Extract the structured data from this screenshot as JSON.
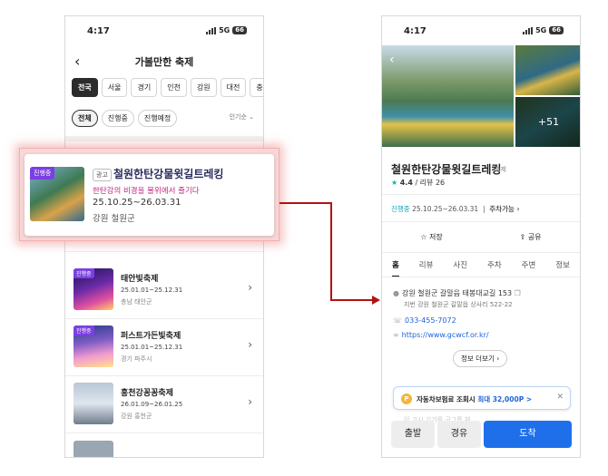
{
  "left_screen": {
    "status": {
      "time": "4:17",
      "network": "5G",
      "battery": "66"
    },
    "header": {
      "title": "가볼만한 축제"
    },
    "regions": [
      "전국",
      "서울",
      "경기",
      "인천",
      "강원",
      "대전",
      "충남"
    ],
    "active_region": "전국",
    "filters": [
      "전체",
      "진행중",
      "진행예정"
    ],
    "sort": "인기순 ⌄",
    "festivals": [
      {
        "badge": "진행중",
        "name": "태안빛축제",
        "date": "25.01.01~25.12.31",
        "location": "충남 태안군"
      },
      {
        "badge": "진행중",
        "name": "퍼스트가든빛축제",
        "date": "25.01.01~25.12.31",
        "location": "경기 파주시"
      },
      {
        "badge": "",
        "name": "홍천강꽁꽁축제",
        "date": "26.01.09~26.01.25",
        "location": "강원 홍천군"
      }
    ]
  },
  "highlight_card": {
    "badge": "진행중",
    "ad_label": "광고",
    "name": "철원한탄강물윗길트레킹",
    "subtitle": "한탄강의 비경을 물위에서 즐기다",
    "date": "25.10.25~26.03.31",
    "location": "강원 철원군"
  },
  "right_screen": {
    "status": {
      "time": "4:17",
      "network": "5G",
      "battery": "66"
    },
    "gallery": {
      "more_count": "+51"
    },
    "place": {
      "name": "철원한탄강물윗길트레킹",
      "category": "축제",
      "rating": "4.4",
      "reviews": "/ 리뷰 26",
      "status": "진행중",
      "period": "25.10.25~26.03.31",
      "parking": "주차가능 ›"
    },
    "actions": {
      "save": "☆ 저장",
      "share": "⇪ 공유"
    },
    "tabs": [
      "홈",
      "리뷰",
      "사진",
      "주차",
      "주변",
      "정보"
    ],
    "active_tab": "홈",
    "info": {
      "address": "강원 철원군 갈말읍 태봉대교길 153",
      "jibun": "지번  강원 철원군 갈말읍 상사리 522-22",
      "phone": "033-455-7072",
      "url": "https://www.gcwcf.or.kr/"
    },
    "more_info": "정보 더보기 ›",
    "banner": {
      "text": "자동차보험료 조회시",
      "highlight": "최대 32,000P >"
    },
    "faded_text": "이 고시 기기를 구그룹 채",
    "bottom_buttons": {
      "start": "출발",
      "via": "경유",
      "arrive": "도착"
    },
    "colors": {
      "primary": "#1f6feb",
      "badge": "#7b3fe4",
      "arrow": "#b31111"
    }
  }
}
